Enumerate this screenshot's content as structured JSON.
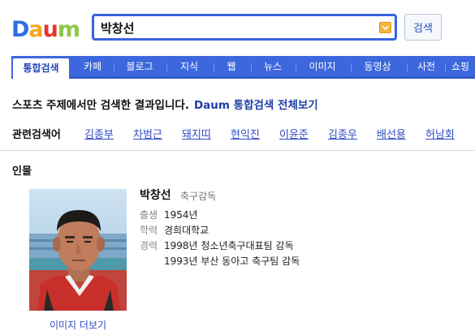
{
  "header": {
    "logo_letters": [
      "D",
      "a",
      "u",
      "m"
    ],
    "logo_colors": [
      "#2f6de6",
      "#f5a623",
      "#e8362e",
      "#8dc63f"
    ],
    "search_value": "박창선",
    "search_button": "검색",
    "accent_color": "#3d67dd"
  },
  "tabs": [
    {
      "label": "통합검색",
      "active": true
    },
    {
      "label": "카페",
      "active": false
    },
    {
      "label": "블로그",
      "active": false
    },
    {
      "label": "지식",
      "active": false
    },
    {
      "label": "웹",
      "active": false
    },
    {
      "label": "뉴스",
      "active": false
    },
    {
      "label": "이미지",
      "active": false
    },
    {
      "label": "동영상",
      "active": false
    },
    {
      "label": "사전",
      "active": false
    },
    {
      "label": "쇼핑",
      "active": false
    }
  ],
  "notice": {
    "text": "스포츠 주제에서만 검색한 결과입니다.",
    "link": "Daum 통합검색 전체보기"
  },
  "related": {
    "title": "관련검색어",
    "items": [
      "김종부",
      "차범근",
      "돼지띠",
      "현익진",
      "이윤준",
      "김종우",
      "배선용",
      "허남회"
    ]
  },
  "people": {
    "section_title": "인물",
    "name": "박창선",
    "role": "축구감독",
    "more_images": "이미지 더보기",
    "rows": [
      {
        "label": "출생",
        "value": "1954년"
      },
      {
        "label": "학력",
        "value": "경희대학교"
      },
      {
        "label": "경력",
        "value": "1998년 청소년축구대표팀 감독"
      },
      {
        "label": "",
        "value": "1993년 부산 동아고 축구팀 감독"
      }
    ]
  }
}
